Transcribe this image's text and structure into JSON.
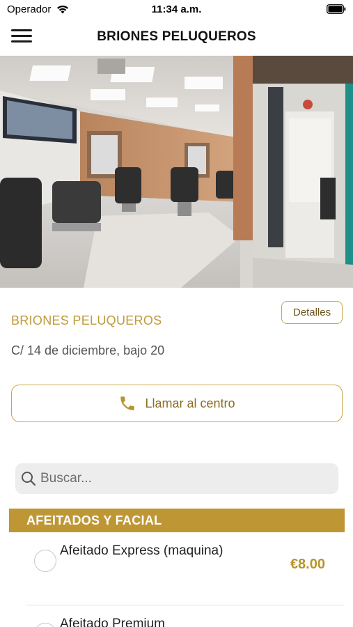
{
  "status_bar": {
    "carrier": "Operador",
    "time": "11:34 a.m."
  },
  "nav": {
    "title": "BRIONES PELUQUEROS",
    "menu_icon": "hamburger-menu-icon"
  },
  "hero": {
    "image_alt": "Interior de la peluquería"
  },
  "salon": {
    "name": "BRIONES PELUQUEROS",
    "details_label": "Detalles",
    "address": "C/ 14 de diciembre, bajo 20"
  },
  "call": {
    "label": "Llamar al centro",
    "icon": "phone-icon"
  },
  "search": {
    "placeholder": "Buscar...",
    "value": ""
  },
  "category": {
    "label": "AFEITADOS Y FACIAL"
  },
  "services": [
    {
      "name": "Afeitado Express (maquina)",
      "price": "€8.00"
    },
    {
      "name": "Afeitado Premium",
      "price": ""
    }
  ],
  "colors": {
    "accent": "#bf9634",
    "accent_text": "#b8942f"
  }
}
